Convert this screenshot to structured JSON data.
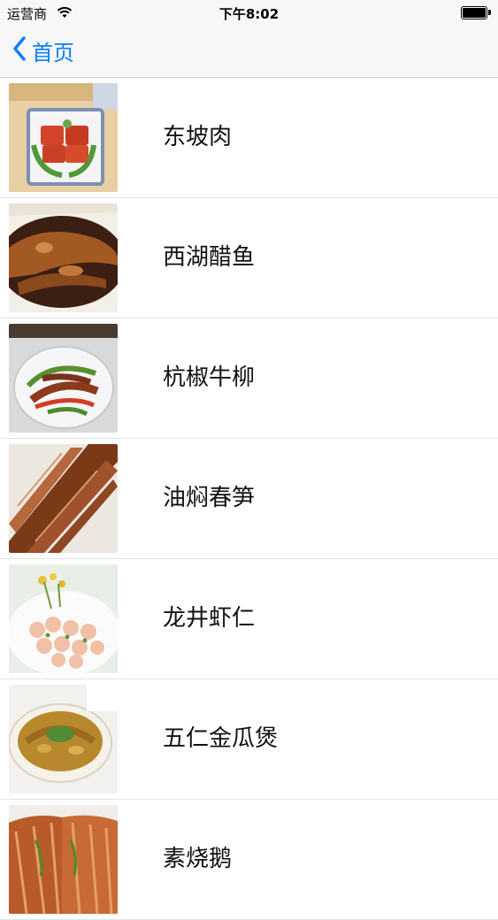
{
  "status_bar": {
    "carrier": "运营商",
    "time": "下午8:02",
    "wifi_icon": "wifi-icon",
    "battery_icon": "battery-icon"
  },
  "nav_bar": {
    "back_icon": "chevron-left-icon",
    "back_label": "首页"
  },
  "dishes": [
    {
      "name": "东坡肉"
    },
    {
      "name": "西湖醋鱼"
    },
    {
      "name": "杭椒牛柳"
    },
    {
      "name": "油焖春笋"
    },
    {
      "name": "龙井虾仁"
    },
    {
      "name": "五仁金瓜煲"
    },
    {
      "name": "素烧鹅"
    }
  ],
  "colors": {
    "accent": "#0a7cff",
    "bar_background": "#f7f7f7",
    "separator": "#e3e3e3"
  }
}
